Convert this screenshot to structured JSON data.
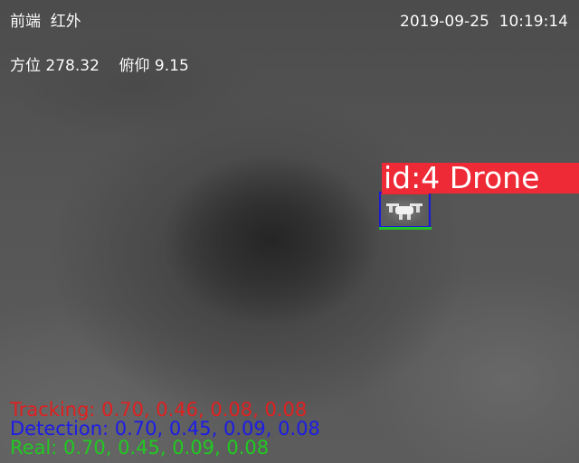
{
  "osd": {
    "mode_label": "前端  红外",
    "datetime": "2019-09-25  10:19:14",
    "angles": "方位 278.32    俯仰 9.15"
  },
  "target": {
    "label": "id:4 Drone",
    "icon": "drone-icon",
    "colors": {
      "label_background": "#ee2a36",
      "tracking_box": "#e8242e",
      "detection_box": "#1a1ad8",
      "real_box": "#22c22a"
    }
  },
  "stats": {
    "tracking": "Tracking: 0.70, 0.46, 0.08, 0.08",
    "detection": "Detection: 0.70, 0.45, 0.09, 0.08",
    "real": "Real: 0.70, 0.45, 0.09, 0.08",
    "colors": {
      "tracking": "#e02020",
      "detection": "#1c1ce6",
      "real": "#22c822"
    }
  }
}
